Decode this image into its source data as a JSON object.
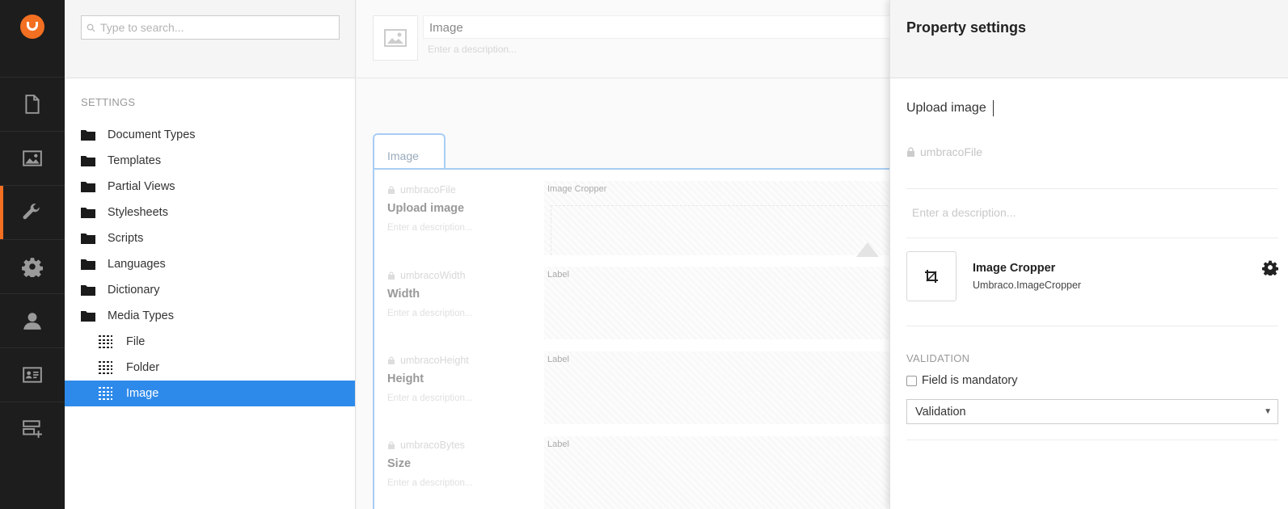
{
  "rail": {
    "sections": [
      {
        "name": "content",
        "icon": "document-icon"
      },
      {
        "name": "media",
        "icon": "image-icon"
      },
      {
        "name": "settings",
        "icon": "wrench-icon",
        "active": true
      },
      {
        "name": "developer",
        "icon": "gear-icon"
      },
      {
        "name": "users",
        "icon": "user-icon"
      },
      {
        "name": "members",
        "icon": "id-card-icon"
      },
      {
        "name": "forms",
        "icon": "form-add-icon"
      }
    ]
  },
  "tree": {
    "search_placeholder": "Type to search...",
    "section_title": "SETTINGS",
    "items": [
      {
        "label": "Document Types"
      },
      {
        "label": "Templates"
      },
      {
        "label": "Partial Views"
      },
      {
        "label": "Stylesheets"
      },
      {
        "label": "Scripts"
      },
      {
        "label": "Languages"
      },
      {
        "label": "Dictionary"
      },
      {
        "label": "Media Types"
      }
    ],
    "children": [
      {
        "label": "File"
      },
      {
        "label": "Folder"
      },
      {
        "label": "Image",
        "selected": true
      }
    ]
  },
  "main": {
    "name_value": "Image",
    "description_placeholder": "Enter a description...",
    "tab_label": "Image",
    "properties": [
      {
        "alias": "umbracoFile",
        "name": "Upload image",
        "description": "Enter a description...",
        "editor_label": "Image Cropper"
      },
      {
        "alias": "umbracoWidth",
        "name": "Width",
        "description": "Enter a description...",
        "editor_label": "Label"
      },
      {
        "alias": "umbracoHeight",
        "name": "Height",
        "description": "Enter a description...",
        "editor_label": "Label"
      },
      {
        "alias": "umbracoBytes",
        "name": "Size",
        "description": "Enter a description...",
        "editor_label": "Label"
      }
    ]
  },
  "panel": {
    "title": "Property settings",
    "property_name": "Upload image",
    "alias": "umbracoFile",
    "description_placeholder": "Enter a description...",
    "editor": {
      "name": "Image Cropper",
      "alias": "Umbraco.ImageCropper"
    },
    "validation_title": "VALIDATION",
    "mandatory_label": "Field is mandatory",
    "mandatory_checked": false,
    "validation_select": "Validation"
  },
  "colors": {
    "rail_bg": "#1d1d1d",
    "accent": "#f36f21",
    "selected": "#2e8aea"
  }
}
